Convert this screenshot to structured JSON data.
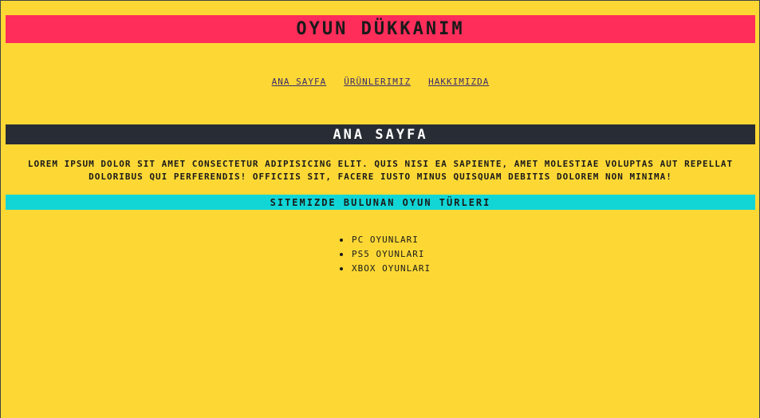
{
  "header": {
    "title": "OYUN DÜKKANım"
  },
  "nav": {
    "items": [
      {
        "label": "ANA SAYFA"
      },
      {
        "label": "ÜRÜNLERIMIZ"
      },
      {
        "label": "HAKKIMIZDA"
      }
    ]
  },
  "main": {
    "section_title": "ANA SAYFA",
    "intro": "LOREM IPSUM DOLOR SIT AMET CONSECTETUR ADIPISICING ELIT. QUIS NISI EA SAPIENTE, AMET MOLESTIAE VOLUPTAS AUT REPELLAT DOLORIBUS QUI PERFERENDIS! OFFICIIS SIT, FACERE IUSTO MINUS QUISQUAM DEBITIS DOLOREM NON MINIMA!",
    "genres_title": "SITEMIZDE BULUNAN OYUN TÜRLERI",
    "genres": [
      {
        "label": "PC OYUNLARI"
      },
      {
        "label": "PS5 OYUNLARI"
      },
      {
        "label": "XBOX OYUNLARI"
      }
    ]
  },
  "colors": {
    "background": "#fdd835",
    "header": "#ff2d5a",
    "section_bar": "#282c34",
    "subsection_bar": "#12d6d6",
    "link": "#3b2a6b"
  }
}
